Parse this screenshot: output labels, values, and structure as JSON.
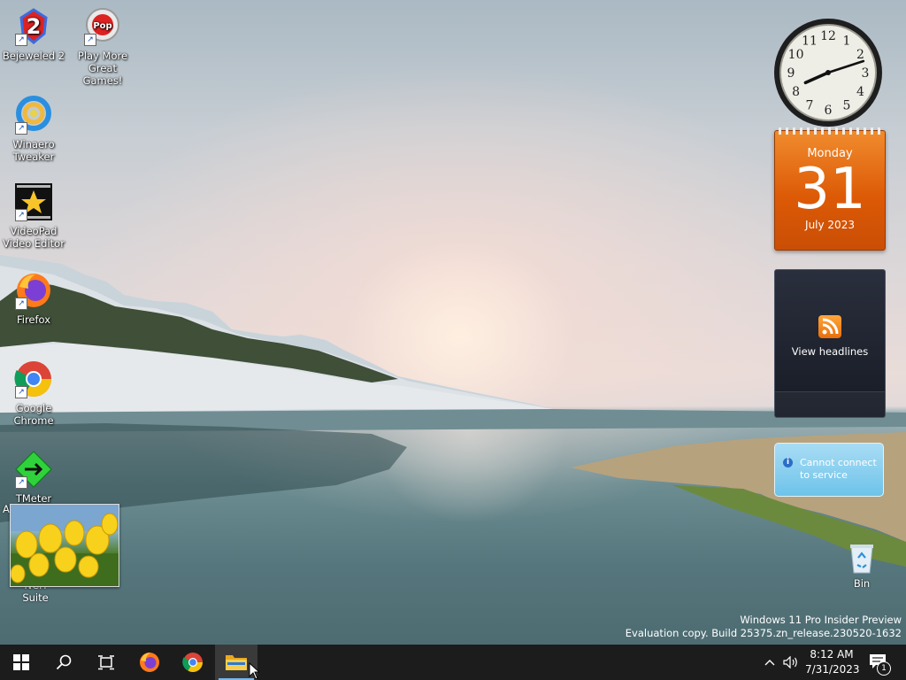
{
  "desktop_icons": [
    {
      "name": "bejeweled",
      "label": "Bejeweled 2"
    },
    {
      "name": "popcap",
      "label": "Play More Great Games!"
    },
    {
      "name": "winaero",
      "label": "Winaero Tweaker"
    },
    {
      "name": "videopad",
      "label": "VideoPad Video Editor"
    },
    {
      "name": "firefox",
      "label": "Firefox"
    },
    {
      "name": "chrome",
      "label": "Google Chrome"
    },
    {
      "name": "tmeter",
      "label": "TMeter"
    }
  ],
  "partial_labels": {
    "left_cut": "Ac",
    "under_photo": "NCH Suite"
  },
  "clock_gadget": {
    "numerals": [
      "12",
      "1",
      "2",
      "3",
      "4",
      "5",
      "6",
      "7",
      "8",
      "9",
      "10",
      "11"
    ],
    "hour": 8,
    "minute": 12
  },
  "calendar_gadget": {
    "weekday": "Monday",
    "day": "31",
    "month_year": "July 2023"
  },
  "feed_gadget": {
    "label": "View headlines"
  },
  "weather_gadget": {
    "line1": "Cannot connect",
    "line2": "to service"
  },
  "recycle_bin": {
    "label": "Bin"
  },
  "watermark": {
    "line1": "Windows 11 Pro Insider Preview",
    "line2": "Evaluation copy. Build 25375.zn_release.230520-1632"
  },
  "taskbar": {
    "time": "8:12 AM",
    "date": "7/31/2023",
    "notification_count": "1",
    "pinned": [
      "start",
      "search",
      "task-view",
      "firefox",
      "chrome",
      "file-explorer"
    ]
  }
}
